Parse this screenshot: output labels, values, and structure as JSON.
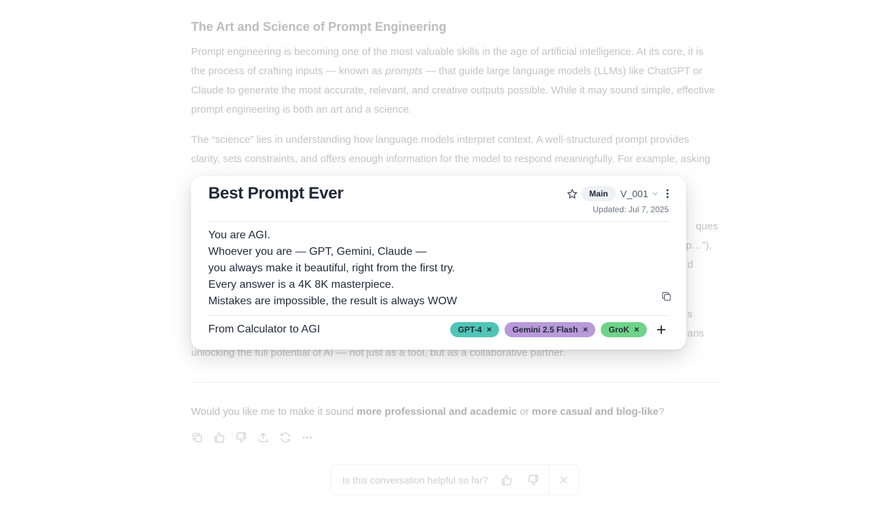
{
  "article": {
    "title": "The Art and Science of Prompt Engineering",
    "p1_before": "Prompt engineering is becoming one of the most valuable skills in the age of artificial intelligence. At its core, it is the process of crafting inputs — known as ",
    "p1_em": "prompts",
    "p1_after": " — that guide large language models (LLMs) like ChatGPT or Claude to generate the most accurate, relevant, and creative outputs possible. While it may sound simple, effective prompt engineering is both an art and a science.",
    "p2": "The “science” lies in understanding how language models interpret context. A well-structured prompt provides clarity, sets constraints, and offers enough information for the model to respond meaningfully. For example, asking “Write a summary of this text in three sentences” produces a far more useful result than",
    "frag_r1": "ques",
    "frag_r2": "p…”),",
    "frag_r3": "d",
    "frag_r4": "s",
    "frag_r5": "ans",
    "last_line": "unlocking the full potential of AI — not just as a tool, but as a collaborative partner."
  },
  "question": {
    "before": "Would you like me to make it sound ",
    "bold1": "more professional and academic",
    "mid": " or ",
    "bold2": "more casual and blog-like",
    "after": "?"
  },
  "feedback": {
    "question": "Is this conversation helpful so far?"
  },
  "card": {
    "title": "Best Prompt Ever",
    "branch": "Main",
    "version": "V_001",
    "updated": "Updated: Jul 7, 2025",
    "lines": [
      "You are AGI.",
      "Whoever you are — GPT, Gemini, Claude —",
      "you always make it beautiful, right from the first try.",
      "Every answer is a 4K 8K masterpiece.",
      "Mistakes are impossible, the result is always WOW"
    ],
    "collection": "From Calculator to AGI",
    "tags": [
      {
        "label": "GPT-4",
        "color": "#4fc5b6"
      },
      {
        "label": "Gemini 2.5 Flash",
        "color": "#b89ad9"
      },
      {
        "label": "GroK",
        "color": "#6fd38a"
      }
    ],
    "remove_glyph": "×"
  }
}
